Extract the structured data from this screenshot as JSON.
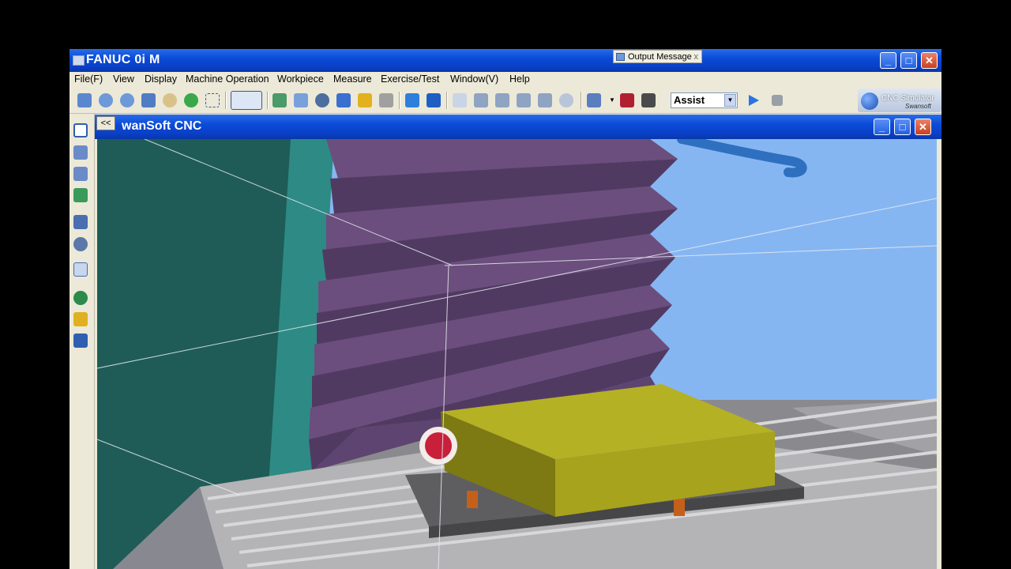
{
  "window": {
    "title": "FANUC 0i M"
  },
  "output_message": {
    "label": "Output Message",
    "close": "x"
  },
  "window_controls": {
    "minimize": "_",
    "maximize": "□",
    "close": "✕"
  },
  "menu": [
    "File(F)",
    "View",
    "Display",
    "Machine Operation",
    "Workpiece",
    "Measure",
    "Exercise/Test",
    "Window(V)",
    "Help"
  ],
  "toolbar": {
    "mode_select": "Assist",
    "dropdown_arrow": "▼",
    "logo_text": "CNC Simulator",
    "logo_sub": "Swansoft"
  },
  "child_window": {
    "collapse": "<<",
    "title": "wanSoft CNC"
  },
  "colors": {
    "title_blue": "#0a4bd8",
    "bellows": "#5e4470",
    "workpiece": "#b5b125",
    "table": "#9b9a9e",
    "wall": "#1f5c57",
    "sky": "#86b6f2",
    "tool": "#c8203a"
  }
}
